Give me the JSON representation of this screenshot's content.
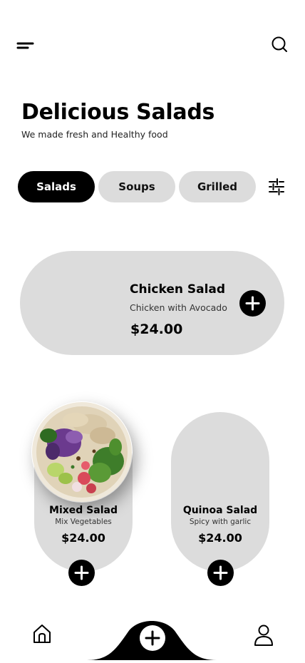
{
  "header": {
    "menu_icon": "hamburger-menu-icon",
    "search_icon": "search-icon",
    "title": "Delicious Salads",
    "subtitle": "We made fresh and Healthy food"
  },
  "tabs": [
    {
      "label": "Salads",
      "active": true
    },
    {
      "label": "Soups",
      "active": false
    },
    {
      "label": "Grilled",
      "active": false
    }
  ],
  "filter_icon": "filter-sliders-icon",
  "featured": {
    "name": "Chicken Salad",
    "description": "Chicken with Avocado",
    "price": "$24.00"
  },
  "products": [
    {
      "name": "Mixed Salad",
      "description": "Mix Vegetables",
      "price": "$24.00"
    },
    {
      "name": "Quinoa Salad",
      "description": "Spicy with garlic",
      "price": "$24.00"
    }
  ],
  "bottom_nav": {
    "home_icon": "home-icon",
    "add_icon": "plus-circle-icon",
    "profile_icon": "user-icon"
  },
  "colors": {
    "primary": "#000000",
    "card_background": "#dcdcdc",
    "page_background": "#ffffff"
  }
}
